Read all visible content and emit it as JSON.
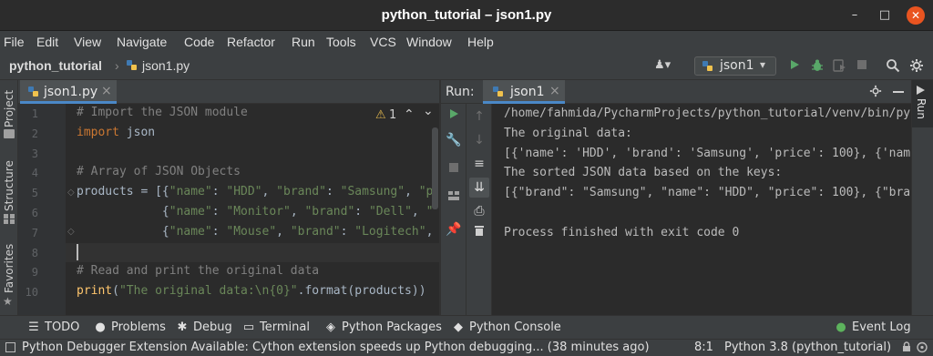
{
  "window": {
    "title": "python_tutorial – json1.py",
    "minimize_glyph": "–",
    "maximize_glyph": "□",
    "close_glyph": "✕"
  },
  "menu": [
    "File",
    "Edit",
    "View",
    "Navigate",
    "Code",
    "Refactor",
    "Run",
    "Tools",
    "VCS",
    "Window",
    "Help"
  ],
  "navbar": {
    "project": "python_tutorial",
    "separator": "›",
    "file": "json1.py",
    "run_config": "json1",
    "run_config_arrow": "▾",
    "user_glyph": "♟▾"
  },
  "left_tabs": [
    "Project",
    "Structure",
    "Favorites"
  ],
  "right_tabs": [
    "Run"
  ],
  "editor": {
    "tab_label": "json1.py",
    "tab_close": "×",
    "inspection_count": "1",
    "inspection_icon": "⚠",
    "nav_up": "⌃",
    "nav_down": "⌄",
    "line_numbers": [
      "1",
      "2",
      "3",
      "4",
      "5",
      "6",
      "7",
      "8",
      "9",
      "10"
    ],
    "lines": [
      [
        {
          "c": "cmt",
          "t": "# Import the JSON module"
        }
      ],
      [
        {
          "c": "kw",
          "t": "import"
        },
        {
          "c": "",
          "t": " json"
        }
      ],
      [],
      [
        {
          "c": "cmt",
          "t": "# Array of JSON Objects"
        }
      ],
      [
        {
          "c": "",
          "t": "products = [{"
        },
        {
          "c": "str",
          "t": "\"name\""
        },
        {
          "c": "",
          "t": ": "
        },
        {
          "c": "str",
          "t": "\"HDD\""
        },
        {
          "c": "",
          "t": ", "
        },
        {
          "c": "str",
          "t": "\"brand\""
        },
        {
          "c": "",
          "t": ": "
        },
        {
          "c": "str",
          "t": "\"Samsung\""
        },
        {
          "c": "",
          "t": ", "
        },
        {
          "c": "str",
          "t": "\"p"
        }
      ],
      [
        {
          "c": "",
          "t": "            {"
        },
        {
          "c": "str",
          "t": "\"name\""
        },
        {
          "c": "",
          "t": ": "
        },
        {
          "c": "str",
          "t": "\"Monitor\""
        },
        {
          "c": "",
          "t": ", "
        },
        {
          "c": "str",
          "t": "\"brand\""
        },
        {
          "c": "",
          "t": ": "
        },
        {
          "c": "str",
          "t": "\"Dell\""
        },
        {
          "c": "",
          "t": ", "
        },
        {
          "c": "str",
          "t": "\""
        }
      ],
      [
        {
          "c": "",
          "t": "            {"
        },
        {
          "c": "str",
          "t": "\"name\""
        },
        {
          "c": "",
          "t": ": "
        },
        {
          "c": "str",
          "t": "\"Mouse\""
        },
        {
          "c": "",
          "t": ", "
        },
        {
          "c": "str",
          "t": "\"brand\""
        },
        {
          "c": "",
          "t": ": "
        },
        {
          "c": "str",
          "t": "\"Logitech\""
        },
        {
          "c": "",
          "t": ","
        }
      ],
      [],
      [
        {
          "c": "cmt",
          "t": "# Read and print the original data"
        }
      ],
      [
        {
          "c": "fn",
          "t": "print"
        },
        {
          "c": "",
          "t": "("
        },
        {
          "c": "str",
          "t": "\"The original data:\\n{0}\""
        },
        {
          "c": "",
          "t": ".format(products))"
        }
      ]
    ]
  },
  "run": {
    "label": "Run:",
    "tab_label": "json1",
    "tab_close": "×",
    "output": [
      "/home/fahmida/PycharmProjects/python_tutorial/venv/bin/py",
      "The original data:",
      "[{'name': 'HDD', 'brand': 'Samsung', 'price': 100}, {'nam",
      "The sorted JSON data based on the keys:",
      "[{\"brand\": \"Samsung\", \"name\": \"HDD\", \"price\": 100}, {\"bra",
      "",
      "Process finished with exit code 0"
    ]
  },
  "bottom_tools": [
    {
      "icon": "☰",
      "label": "TODO"
    },
    {
      "icon": "●",
      "label": "Problems"
    },
    {
      "icon": "✱",
      "label": "Debug"
    },
    {
      "icon": "▭",
      "label": "Terminal"
    },
    {
      "icon": "◈",
      "label": "Python Packages"
    },
    {
      "icon": "◆",
      "label": "Python Console"
    },
    {
      "icon": "●",
      "label": "Event Log"
    }
  ],
  "status": {
    "message": "Python Debugger Extension Available: Cython extension speeds up Python debugging... (38 minutes ago)",
    "position": "8:1",
    "interpreter": "Python 3.8 (python_tutorial)",
    "lock_glyph": "🔒"
  },
  "colors": {
    "run_green": "#59a869",
    "debug_green": "#59a869",
    "close_orange": "#e95420",
    "accent_blue": "#4a88c7",
    "event_log_green": "#5db35d"
  }
}
